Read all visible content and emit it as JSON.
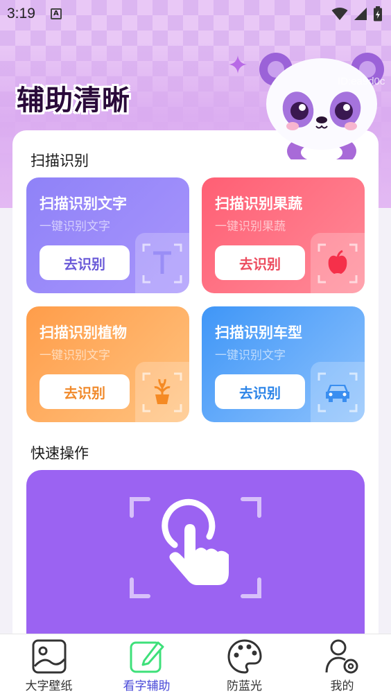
{
  "status_bar": {
    "time": "3:19",
    "notification_badge": "A",
    "icons": [
      "wifi-icon",
      "cell-signal-icon",
      "battery-icon"
    ]
  },
  "header": {
    "title": "辅助清晰",
    "id_tag": "ID:ea9d0c"
  },
  "scan_section": {
    "title": "扫描识别",
    "tiles": [
      {
        "title": "扫描识别文字",
        "subtitle": "一键识别文字",
        "button": "去识别",
        "icon": "text-t-icon",
        "color": "#8f82f8"
      },
      {
        "title": "扫描识别果蔬",
        "subtitle": "一键识别果蔬",
        "button": "去识别",
        "icon": "apple-icon",
        "color": "#ff5f74"
      },
      {
        "title": "扫描识别植物",
        "subtitle": "一键识别文字",
        "button": "去识别",
        "icon": "plant-icon",
        "color": "#ff9d4a"
      },
      {
        "title": "扫描识别车型",
        "subtitle": "一键识别文字",
        "button": "去识别",
        "icon": "car-icon",
        "color": "#3f96f7"
      }
    ]
  },
  "quick_section": {
    "title": "快速操作",
    "icon": "tap-hand-icon",
    "color": "#9b63f2"
  },
  "bottom_nav": {
    "items": [
      {
        "label": "大字壁纸",
        "icon": "image-icon",
        "active": false
      },
      {
        "label": "看字辅助",
        "icon": "edit-icon",
        "active": true
      },
      {
        "label": "防蓝光",
        "icon": "palette-icon",
        "active": false
      },
      {
        "label": "我的",
        "icon": "user-settings-icon",
        "active": false
      }
    ],
    "active_color": "#4a4ad8"
  }
}
